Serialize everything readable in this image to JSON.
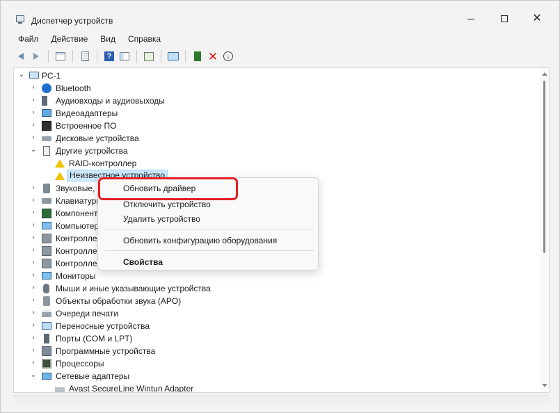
{
  "window": {
    "title": "Диспетчер устройств"
  },
  "menubar": {
    "items": [
      "Файл",
      "Действие",
      "Вид",
      "Справка"
    ]
  },
  "tree": {
    "root": "PC-1",
    "categories": [
      "Bluetooth",
      "Аудиовходы и аудиовыходы",
      "Видеоадаптеры",
      "Встроенное ПО",
      "Дисковые устройства",
      "Другие устройства",
      "Звуковые,",
      "Клавиатуры",
      "Компонент",
      "Компьютер",
      "Контролле",
      "Контролле",
      "Контролле",
      "Мониторы",
      "Мыши и иные указывающие устройства",
      "Объекты обработки звука (APO)",
      "Очереди печати",
      "Переносные устройства",
      "Порты (COM и LPT)",
      "Программные устройства",
      "Процессоры",
      "Сетевые адаптеры"
    ],
    "other_devices_children": [
      "RAID-контроллер",
      "Неизвестное устройство"
    ],
    "network_children": [
      "Avast SecureLine Wintun Adapter"
    ]
  },
  "context_menu": {
    "items": [
      "Обновить драйвер",
      "Отключить устройство",
      "Удалить устройство",
      "Обновить конфигурацию оборудования",
      "Свойства"
    ]
  },
  "colors": {
    "highlight": "#e31e24",
    "selection": "#cce8ff",
    "delete_icon": "#e0161b"
  },
  "icons": {
    "toolbar": [
      "back-arrow-icon",
      "forward-arrow-icon",
      "device-grid-icon",
      "document-icon",
      "help-icon",
      "properties-icon",
      "scan-hardware-icon",
      "monitor-icon",
      "update-driver-icon",
      "remove-icon",
      "download-icon"
    ]
  }
}
